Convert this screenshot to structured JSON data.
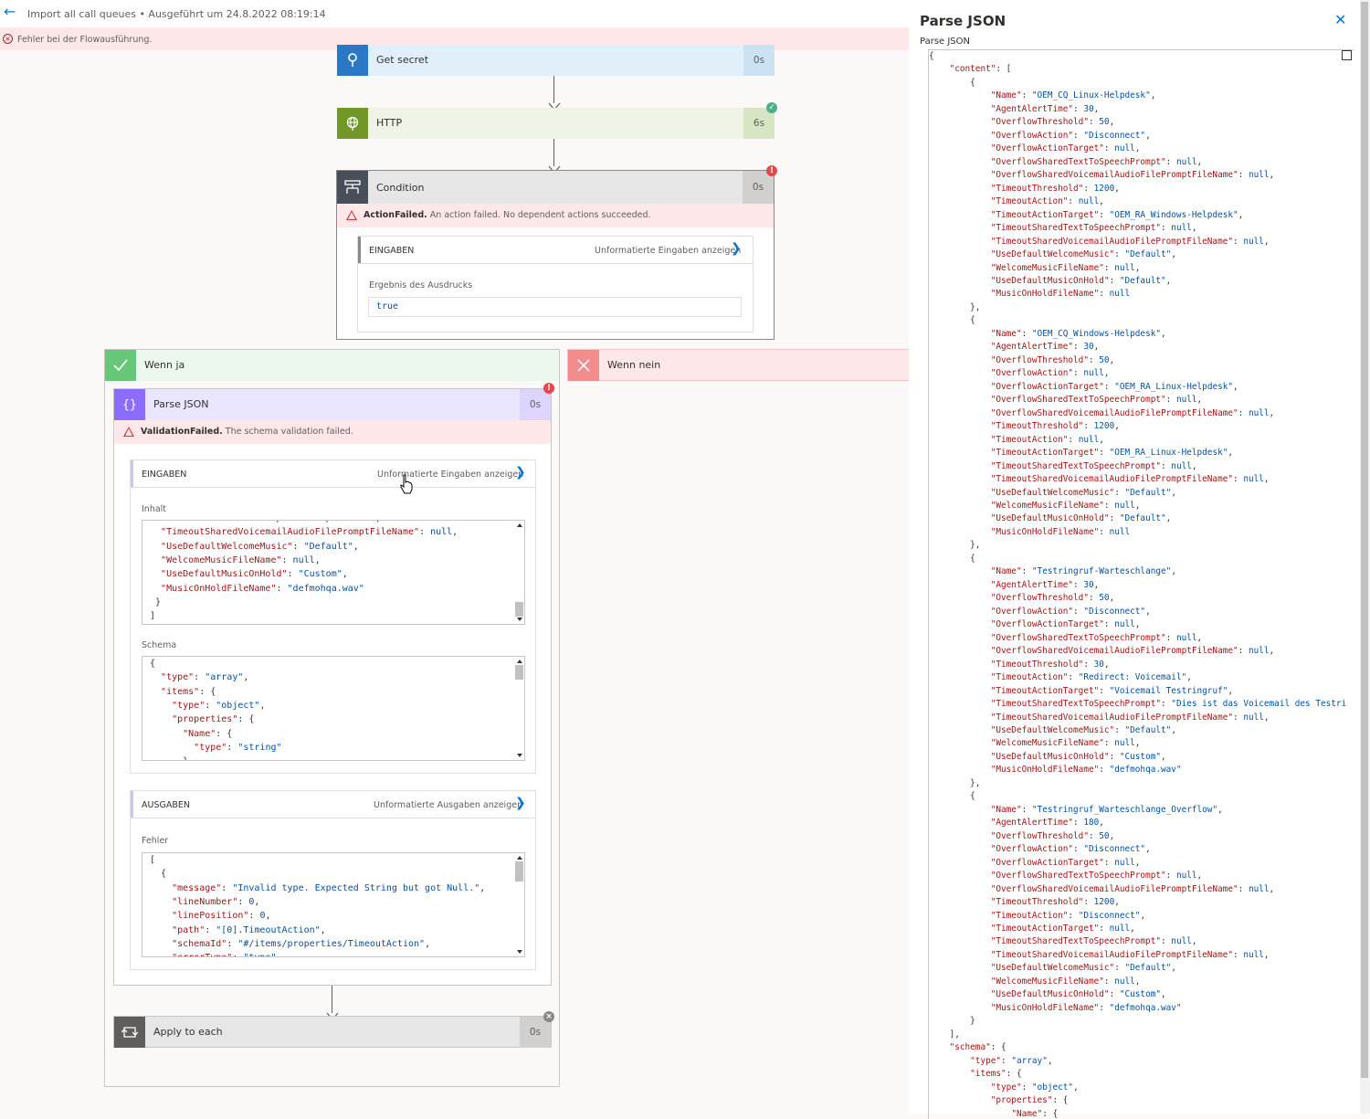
{
  "header": {
    "title": "Import all call queues • Ausgeführt um 24.8.2022 08:19:14",
    "error_message": "Fehler bei der Flowausführung."
  },
  "flow": {
    "get_secret": {
      "title": "Get secret",
      "duration": "0s"
    },
    "http": {
      "title": "HTTP",
      "duration": "6s"
    },
    "condition": {
      "title": "Condition",
      "duration": "0s",
      "error_type": "ActionFailed.",
      "error_text": " An action failed. No dependent actions succeeded.",
      "inputs_header": "EINGABEN",
      "inputs_link": "Unformatierte Eingaben anzeigen",
      "result_label": "Ergebnis des Ausdrucks",
      "result_value": "true"
    },
    "branch_yes": {
      "title": "Wenn ja"
    },
    "branch_no": {
      "title": "Wenn nein"
    },
    "parse_json": {
      "title": "Parse JSON",
      "duration": "0s",
      "error_type": "ValidationFailed.",
      "error_text": " The schema validation failed.",
      "inputs_header": "EINGABEN",
      "inputs_link": "Unformatierte Eingaben anzeigen",
      "content_label": "Inhalt",
      "content_lines": [
        "  \"TimeoutSharedTextToSpeechPrompt\": null,",
        "  \"TimeoutSharedVoicemailAudioFilePromptFileName\": null,",
        "  \"UseDefaultWelcomeMusic\": \"Default\",",
        "  \"WelcomeMusicFileName\": null,",
        "  \"UseDefaultMusicOnHold\": \"Custom\",",
        "  \"MusicOnHoldFileName\": \"defmohqa.wav\"",
        " }",
        "]"
      ],
      "schema_label": "Schema",
      "schema_lines": [
        "{",
        "  \"type\": \"array\",",
        "  \"items\": {",
        "    \"type\": \"object\",",
        "    \"properties\": {",
        "      \"Name\": {",
        "        \"type\": \"string\"",
        "      },"
      ],
      "outputs_header": "AUSGABEN",
      "outputs_link": "Unformatierte Ausgaben anzeigen",
      "errors_label": "Fehler",
      "error_lines": [
        "[",
        "  {",
        "    \"message\": \"Invalid type. Expected String but got Null.\",",
        "    \"lineNumber\": 0,",
        "    \"linePosition\": 0,",
        "    \"path\": \"[0].TimeoutAction\",",
        "    \"schemaId\": \"#/items/properties/TimeoutAction\",",
        "    \"errorType\": \"type\","
      ]
    },
    "apply_each": {
      "title": "Apply to each",
      "duration": "0s"
    }
  },
  "side_panel": {
    "title": "Parse JSON",
    "subtitle": "Parse JSON",
    "json_lines": [
      "{",
      "    \"content\": [",
      "        {",
      "            \"Name\": \"OEM_CQ_Linux-Helpdesk\",",
      "            \"AgentAlertTime\": 30,",
      "            \"OverflowThreshold\": 50,",
      "            \"OverflowAction\": \"Disconnect\",",
      "            \"OverflowActionTarget\": null,",
      "            \"OverflowSharedTextToSpeechPrompt\": null,",
      "            \"OverflowSharedVoicemailAudioFilePromptFileName\": null,",
      "            \"TimeoutThreshold\": 1200,",
      "            \"TimeoutAction\": null,",
      "            \"TimeoutActionTarget\": \"OEM_RA_Windows-Helpdesk\",",
      "            \"TimeoutSharedTextToSpeechPrompt\": null,",
      "            \"TimeoutSharedVoicemailAudioFilePromptFileName\": null,",
      "            \"UseDefaultWelcomeMusic\": \"Default\",",
      "            \"WelcomeMusicFileName\": null,",
      "            \"UseDefaultMusicOnHold\": \"Default\",",
      "            \"MusicOnHoldFileName\": null",
      "        },",
      "        {",
      "            \"Name\": \"OEM_CQ_Windows-Helpdesk\",",
      "            \"AgentAlertTime\": 30,",
      "            \"OverflowThreshold\": 50,",
      "            \"OverflowAction\": null,",
      "            \"OverflowActionTarget\": \"OEM_RA_Linux-Helpdesk\",",
      "            \"OverflowSharedTextToSpeechPrompt\": null,",
      "            \"OverflowSharedVoicemailAudioFilePromptFileName\": null,",
      "            \"TimeoutThreshold\": 1200,",
      "            \"TimeoutAction\": null,",
      "            \"TimeoutActionTarget\": \"OEM_RA_Linux-Helpdesk\",",
      "            \"TimeoutSharedTextToSpeechPrompt\": null,",
      "            \"TimeoutSharedVoicemailAudioFilePromptFileName\": null,",
      "            \"UseDefaultWelcomeMusic\": \"Default\",",
      "            \"WelcomeMusicFileName\": null,",
      "            \"UseDefaultMusicOnHold\": \"Default\",",
      "            \"MusicOnHoldFileName\": null",
      "        },",
      "        {",
      "            \"Name\": \"Testringruf-Warteschlange\",",
      "            \"AgentAlertTime\": 30,",
      "            \"OverflowThreshold\": 50,",
      "            \"OverflowAction\": \"Disconnect\",",
      "            \"OverflowActionTarget\": null,",
      "            \"OverflowSharedTextToSpeechPrompt\": null,",
      "            \"OverflowSharedVoicemailAudioFilePromptFileName\": null,",
      "            \"TimeoutThreshold\": 30,",
      "            \"TimeoutAction\": \"Redirect: Voicemail\",",
      "            \"TimeoutActionTarget\": \"Voicemail Testringruf\",",
      "            \"TimeoutSharedTextToSpeechPrompt\": \"Dies ist das Voicemail des Testri",
      "            \"TimeoutSharedVoicemailAudioFilePromptFileName\": null,",
      "            \"UseDefaultWelcomeMusic\": \"Default\",",
      "            \"WelcomeMusicFileName\": null,",
      "            \"UseDefaultMusicOnHold\": \"Custom\",",
      "            \"MusicOnHoldFileName\": \"defmohqa.wav\"",
      "        },",
      "        {",
      "            \"Name\": \"Testringruf_Warteschlange_Overflow\",",
      "            \"AgentAlertTime\": 180,",
      "            \"OverflowThreshold\": 50,",
      "            \"OverflowAction\": \"Disconnect\",",
      "            \"OverflowActionTarget\": null,",
      "            \"OverflowSharedTextToSpeechPrompt\": null,",
      "            \"OverflowSharedVoicemailAudioFilePromptFileName\": null,",
      "            \"TimeoutThreshold\": 1200,",
      "            \"TimeoutAction\": \"Disconnect\",",
      "            \"TimeoutActionTarget\": null,",
      "            \"TimeoutSharedTextToSpeechPrompt\": null,",
      "            \"TimeoutSharedVoicemailAudioFilePromptFileName\": null,",
      "            \"UseDefaultWelcomeMusic\": \"Default\",",
      "            \"WelcomeMusicFileName\": null,",
      "            \"UseDefaultMusicOnHold\": \"Custom\",",
      "            \"MusicOnHoldFileName\": \"defmohqa.wav\"",
      "        }",
      "    ],",
      "    \"schema\": {",
      "        \"type\": \"array\",",
      "        \"items\": {",
      "            \"type\": \"object\",",
      "            \"properties\": {",
      "                \"Name\": {"
    ]
  },
  "colors": {
    "get_secret": "#2b78c5",
    "http": "#709727",
    "condition": "#484f58",
    "parse_json": "#8c6cff",
    "yes": "#34c759",
    "no": "#f28b8b",
    "error": "#e8474a",
    "success": "#4caf8b"
  }
}
